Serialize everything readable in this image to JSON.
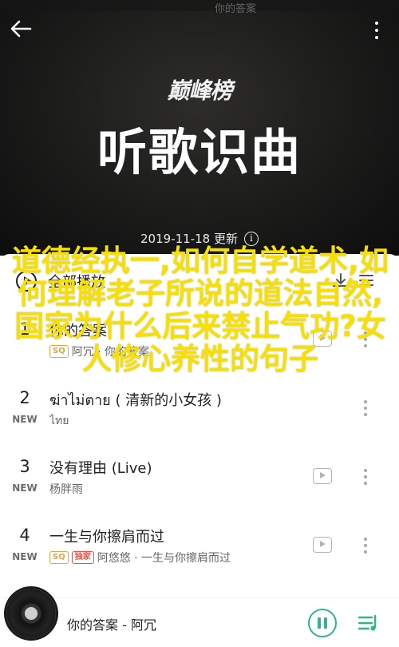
{
  "header": {
    "top_text": "你的答案",
    "brand": "巅峰榜",
    "title": "听歌识曲",
    "update_text": "2019-11-18 更新"
  },
  "play_all": {
    "label": "全部播放",
    "count": ""
  },
  "songs": [
    {
      "rank": "1",
      "tag": "",
      "title": "你的答案",
      "badge": "SQ",
      "meta": "阿冗 · 你的答案"
    },
    {
      "rank": "2",
      "tag": "NEW",
      "title": "ฆ่าไม่ตาย ( 清新的小女孩 )",
      "badge": "",
      "meta": "ไทย"
    },
    {
      "rank": "3",
      "tag": "NEW",
      "title": "没有理由 (Live)",
      "badge": "",
      "meta": "杨胖雨"
    },
    {
      "rank": "4",
      "tag": "NEW",
      "title": "一生与你擦肩而过",
      "badge": "SQ",
      "badge2": "独家",
      "meta": "阿悠悠 · 一生与你擦肩而过"
    }
  ],
  "overlay": {
    "caption": "道德经执一,如何自学道术,如何理解老子所说的道法自然,国家为什么后来禁止气功?女人修心养性的句子"
  },
  "player": {
    "now_playing": "你的答案 - 阿冗"
  },
  "colors": {
    "accent": "#2fb58b",
    "caption": "#f7df00",
    "badge_sq": "#e0a64c",
    "badge_red": "#e7544a"
  }
}
